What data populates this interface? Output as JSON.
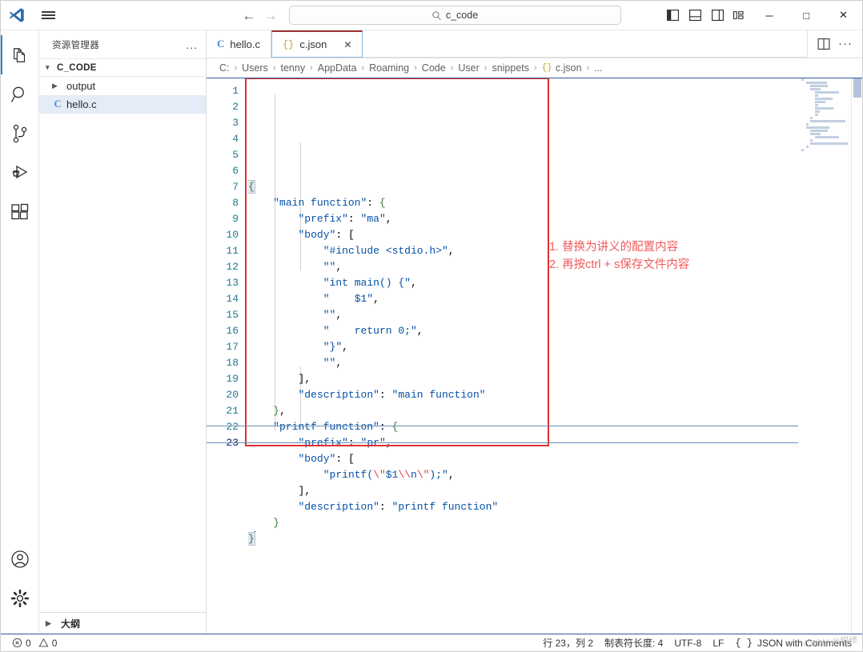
{
  "titlebar": {
    "logo_icon": "vscode-logo-icon",
    "menu_icon": "hamburger-menu-icon",
    "back_icon": "back-arrow-icon",
    "forward_icon": "forward-arrow-icon",
    "search": {
      "icon": "search-icon",
      "value": "c_code",
      "placeholder": "Search"
    },
    "layout_buttons": [
      {
        "name": "toggle-primary-sidebar-button",
        "icon": "panel-left-icon"
      },
      {
        "name": "toggle-panel-button",
        "icon": "panel-bottom-icon"
      },
      {
        "name": "toggle-secondary-sidebar-button",
        "icon": "panel-right-icon"
      },
      {
        "name": "customize-layout-button",
        "icon": "layout-grid-icon"
      }
    ],
    "window_controls": [
      {
        "name": "minimize-button",
        "glyph": "─"
      },
      {
        "name": "maximize-button",
        "glyph": "□"
      },
      {
        "name": "close-button",
        "glyph": "✕"
      }
    ]
  },
  "activitybar": {
    "items": [
      {
        "name": "activity-explorer",
        "icon": "files-icon",
        "active": true
      },
      {
        "name": "activity-search",
        "icon": "search-icon",
        "active": false
      },
      {
        "name": "activity-source-control",
        "icon": "source-control-icon",
        "active": false
      },
      {
        "name": "activity-run-debug",
        "icon": "run-debug-icon",
        "active": false
      },
      {
        "name": "activity-extensions",
        "icon": "extensions-icon",
        "active": false
      }
    ],
    "bottom_items": [
      {
        "name": "activity-accounts",
        "icon": "account-icon"
      },
      {
        "name": "activity-settings",
        "icon": "gear-icon"
      }
    ]
  },
  "sidebar": {
    "title": "资源管理器",
    "more_actions": "...",
    "root": {
      "label": "C_CODE",
      "chevron": "⌄"
    },
    "items": [
      {
        "label": "output",
        "type": "folder",
        "chevron": "›",
        "selected": false
      },
      {
        "label": "hello.c",
        "type": "c-file",
        "badge": "C",
        "selected": true
      }
    ],
    "outline_label": "大纲",
    "outline_chevron": "›"
  },
  "tabs": [
    {
      "label": "hello.c",
      "icon": "c-file-icon",
      "icon_text": "C",
      "active": false,
      "closable": false
    },
    {
      "label": "c.json",
      "icon": "json-file-icon",
      "icon_text": "{}",
      "active": true,
      "closable": true,
      "close_glyph": "✕"
    }
  ],
  "editor_actions": [
    {
      "name": "split-editor-button",
      "icon": "split-editor-icon"
    },
    {
      "name": "editor-more-actions-button",
      "icon": "ellipsis-icon",
      "glyph": "···"
    }
  ],
  "breadcrumbs": {
    "separator": "›",
    "items": [
      "C:",
      "Users",
      "tenny",
      "AppData",
      "Roaming",
      "Code",
      "User",
      "snippets"
    ],
    "file": {
      "icon_text": "{}",
      "label": "c.json"
    },
    "trailing": "..."
  },
  "editor": {
    "language": "JSON with Comments",
    "line_count": 23,
    "cursor_line": 23,
    "lines": [
      {
        "n": 1,
        "text": "{"
      },
      {
        "n": 2,
        "text": "    \"main function\": {"
      },
      {
        "n": 3,
        "text": "        \"prefix\": \"ma\","
      },
      {
        "n": 4,
        "text": "        \"body\": ["
      },
      {
        "n": 5,
        "text": "            \"#include <stdio.h>\","
      },
      {
        "n": 6,
        "text": "            \"\","
      },
      {
        "n": 7,
        "text": "            \"int main() {\","
      },
      {
        "n": 8,
        "text": "            \"    $1\","
      },
      {
        "n": 9,
        "text": "            \"\","
      },
      {
        "n": 10,
        "text": "            \"    return 0;\","
      },
      {
        "n": 11,
        "text": "            \"}\","
      },
      {
        "n": 12,
        "text": "            \"\","
      },
      {
        "n": 13,
        "text": "        ],"
      },
      {
        "n": 14,
        "text": "        \"description\": \"main function\""
      },
      {
        "n": 15,
        "text": "    },"
      },
      {
        "n": 16,
        "text": "    \"printf function\": {"
      },
      {
        "n": 17,
        "text": "        \"prefix\": \"pr\","
      },
      {
        "n": 18,
        "text": "        \"body\": ["
      },
      {
        "n": 19,
        "text": "            \"printf(\\\"$1\\\\n\\\");\","
      },
      {
        "n": 20,
        "text": "        ],"
      },
      {
        "n": 21,
        "text": "        \"description\": \"printf function\""
      },
      {
        "n": 22,
        "text": "    }"
      },
      {
        "n": 23,
        "text": "}"
      }
    ]
  },
  "annotation": {
    "line1": "1. 替换为讲义的配置内容",
    "line2": "2. 再按ctrl + s保存文件内容",
    "color": "#f05b5b",
    "box_color": "#e03030"
  },
  "statusbar": {
    "errors": {
      "icon": "error-circle-icon",
      "count": "0"
    },
    "warnings": {
      "icon": "warning-triangle-icon",
      "count": "0"
    },
    "position": "行 23，列 2",
    "tab_size": "制表符长度: 4",
    "encoding": "UTF-8",
    "eol": "LF",
    "language_icon": "{ }",
    "language": "JSON with Comments",
    "watermark": "CSDN @程修"
  },
  "colors": {
    "accent": "#2488db",
    "json_key": "#0451a5",
    "json_string": "#0451a5",
    "escape": "#e03a3a",
    "brace_green": "#3b7a3b",
    "gutter": "#237893",
    "selection": "#e4ecf7",
    "annotation_red": "#f05b5b"
  }
}
